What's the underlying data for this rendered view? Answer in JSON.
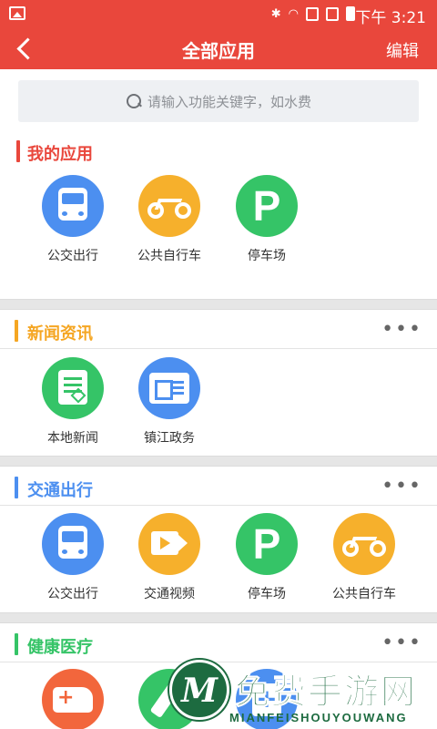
{
  "status_bar": {
    "time": "下午 3:21"
  },
  "nav": {
    "title": "全部应用",
    "edit_label": "编辑"
  },
  "search": {
    "placeholder": "请输入功能关键字，如水费"
  },
  "colors": {
    "accent": "#e9473c",
    "my_apps": "#e9473c",
    "news": "#f5a623",
    "traffic": "#4c8ff0",
    "health": "#35c467"
  },
  "sections": {
    "my_apps": {
      "title": "我的应用",
      "items": [
        {
          "label": "公交出行",
          "icon": "bus-icon"
        },
        {
          "label": "公共自行车",
          "icon": "bicycle-icon"
        },
        {
          "label": "停车场",
          "icon": "parking-icon"
        }
      ]
    },
    "news": {
      "title": "新闻资讯",
      "more": "•••",
      "items": [
        {
          "label": "本地新闻",
          "icon": "news-icon"
        },
        {
          "label": "镇江政务",
          "icon": "government-icon"
        }
      ]
    },
    "traffic": {
      "title": "交通出行",
      "more": "•••",
      "items": [
        {
          "label": "公交出行",
          "icon": "bus-icon"
        },
        {
          "label": "交通视频",
          "icon": "video-icon"
        },
        {
          "label": "停车场",
          "icon": "parking-icon"
        },
        {
          "label": "公共自行车",
          "icon": "bicycle-icon"
        }
      ]
    },
    "health": {
      "title": "健康医疗",
      "more": "•••",
      "items": [
        {
          "icon": "ambulance-icon"
        },
        {
          "icon": "pen-icon"
        },
        {
          "icon": "medical-record-icon"
        }
      ]
    }
  },
  "watermark": {
    "main": "免费手游网",
    "sub": "MIANFEISHOUYOUWANG"
  }
}
